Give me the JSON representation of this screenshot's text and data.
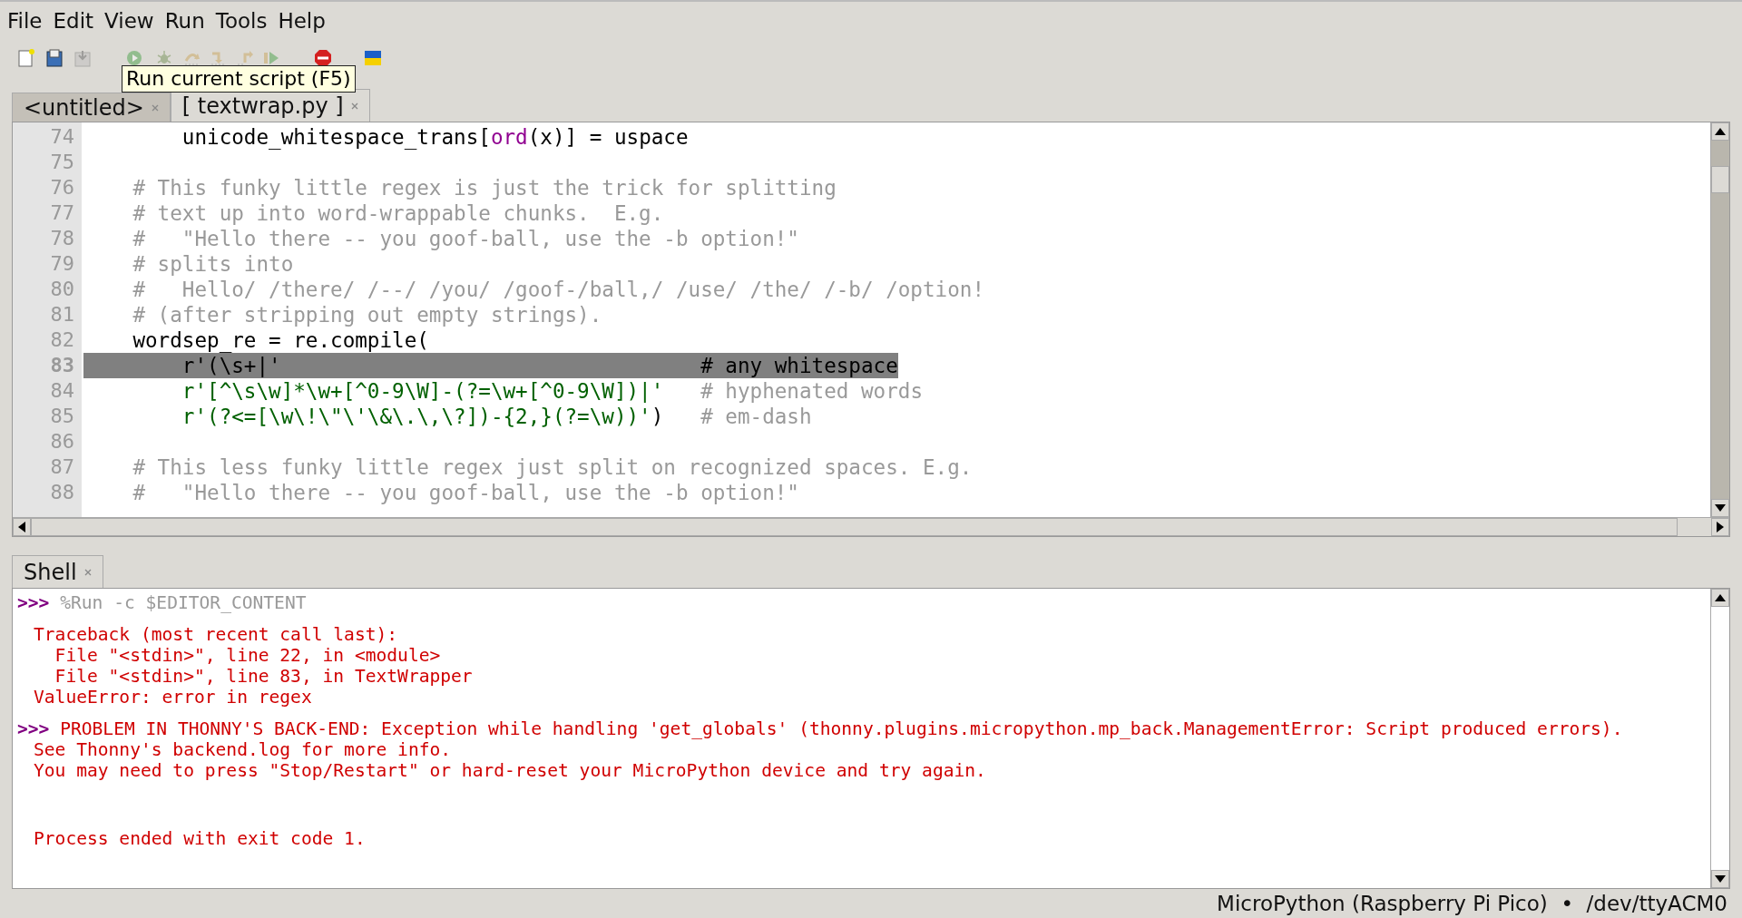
{
  "menu": [
    "File",
    "Edit",
    "View",
    "Run",
    "Tools",
    "Help"
  ],
  "toolbar": [
    {
      "kind": "new",
      "disabled": false
    },
    {
      "kind": "save",
      "disabled": false
    },
    {
      "kind": "saveas",
      "disabled": true
    },
    {
      "kind": "run",
      "disabled": true
    },
    {
      "kind": "debug",
      "disabled": true
    },
    {
      "kind": "stepover",
      "disabled": true
    },
    {
      "kind": "stepinto",
      "disabled": true
    },
    {
      "kind": "stepout",
      "disabled": true
    },
    {
      "kind": "resume",
      "disabled": true
    },
    {
      "kind": "stop",
      "disabled": false
    },
    {
      "kind": "flag",
      "disabled": false
    }
  ],
  "tooltip": "Run current script (F5)",
  "tabs": [
    {
      "label": "<untitled>",
      "selected": false
    },
    {
      "label": "[ textwrap.py ]",
      "selected": true
    }
  ],
  "editor": {
    "lines": [
      {
        "number": "74",
        "highlighted": false,
        "tokens": [
          {
            "kind": "code",
            "text": "        unicode_whitespace_trans["
          },
          {
            "kind": "builtin",
            "text": "ord"
          },
          {
            "kind": "code",
            "text": "(x)] = uspace"
          }
        ]
      },
      {
        "number": "75",
        "highlighted": false
      },
      {
        "number": "76",
        "highlighted": false,
        "tokens": [
          {
            "kind": "comment",
            "text": "    # This funky little regex is just the trick for splitting"
          }
        ]
      },
      {
        "number": "77",
        "highlighted": false,
        "tokens": [
          {
            "kind": "comment",
            "text": "    # text up into word-wrappable chunks.  E.g."
          }
        ]
      },
      {
        "number": "78",
        "highlighted": false,
        "tokens": [
          {
            "kind": "comment",
            "text": "    #   \"Hello there -- you goof-ball, use the -b option!\""
          }
        ]
      },
      {
        "number": "79",
        "highlighted": false,
        "tokens": [
          {
            "kind": "comment",
            "text": "    # splits into"
          }
        ]
      },
      {
        "number": "80",
        "highlighted": false,
        "tokens": [
          {
            "kind": "comment",
            "text": "    #   Hello/ /there/ /--/ /you/ /goof-/ball,/ /use/ /the/ /-b/ /option!"
          }
        ]
      },
      {
        "number": "81",
        "highlighted": false,
        "tokens": [
          {
            "kind": "comment",
            "text": "    # (after stripping out empty strings)."
          }
        ]
      },
      {
        "number": "82",
        "highlighted": false,
        "tokens": [
          {
            "kind": "code",
            "text": "    wordsep_re = re.compile("
          }
        ]
      },
      {
        "number": "83",
        "highlighted": true,
        "tokens": [
          {
            "kind": "code",
            "text": "        r'(\\s+|'                                  # any whitespace"
          }
        ]
      },
      {
        "number": "84",
        "highlighted": false,
        "tokens": [
          {
            "kind": "string",
            "text": "        r'[^\\s\\w]*\\w+[^0-9\\W]-(?=\\w+[^0-9\\W])|'"
          },
          {
            "kind": "comment",
            "text": "   # hyphenated words"
          }
        ]
      },
      {
        "number": "85",
        "highlighted": false,
        "tokens": [
          {
            "kind": "string",
            "text": "        r'(?<=[\\w\\!\\\"\\'\\&\\.\\,\\?])-{2,}(?=\\w))'"
          },
          {
            "kind": "code",
            "text": ")"
          },
          {
            "kind": "comment",
            "text": "   # em-dash"
          }
        ]
      },
      {
        "number": "86",
        "highlighted": false
      },
      {
        "number": "87",
        "highlighted": false,
        "tokens": [
          {
            "kind": "comment",
            "text": "    # This less funky little regex just split on recognized spaces. E.g."
          }
        ]
      },
      {
        "number": "88",
        "highlighted": false,
        "tokens": [
          {
            "kind": "comment",
            "text": "    #   \"Hello there -- you goof-ball, use the -b option!\""
          }
        ]
      }
    ]
  },
  "shell": {
    "tab": "Shell",
    "blocks": [
      {
        "kind": "command",
        "lines": [
          {
            "kind": "prompt",
            "prompt": ">>>",
            "text": "%Run -c $EDITOR_CONTENT"
          }
        ]
      },
      {
        "kind": "output",
        "lines": [
          {
            "kind": "error",
            "text": "Traceback (most recent call last):"
          },
          {
            "kind": "error",
            "text": "  File \"<stdin>\", line 22, in <module>"
          },
          {
            "kind": "error",
            "text": "  File \"<stdin>\", line 83, in TextWrapper"
          },
          {
            "kind": "error",
            "text": "ValueError: error in regex"
          }
        ]
      },
      {
        "kind": "output",
        "lines": [
          {
            "kind": "errprompt",
            "prompt": ">>>",
            "text": "PROBLEM IN THONNY'S BACK-END: Exception while handling 'get_globals' (thonny.plugins.micropython.mp_back.ManagementError: Script produced errors)."
          },
          {
            "kind": "error",
            "text": "See Thonny's backend.log for more info."
          },
          {
            "kind": "error",
            "text": "You may need to press \"Stop/Restart\" or hard-reset your MicroPython device and try again."
          }
        ]
      },
      {
        "kind": "exit",
        "lines": [
          {
            "kind": "error",
            "text": "Process ended with exit code 1."
          }
        ]
      }
    ]
  },
  "status": "MicroPython (Raspberry Pi Pico)  •  /dev/ttyACM0"
}
